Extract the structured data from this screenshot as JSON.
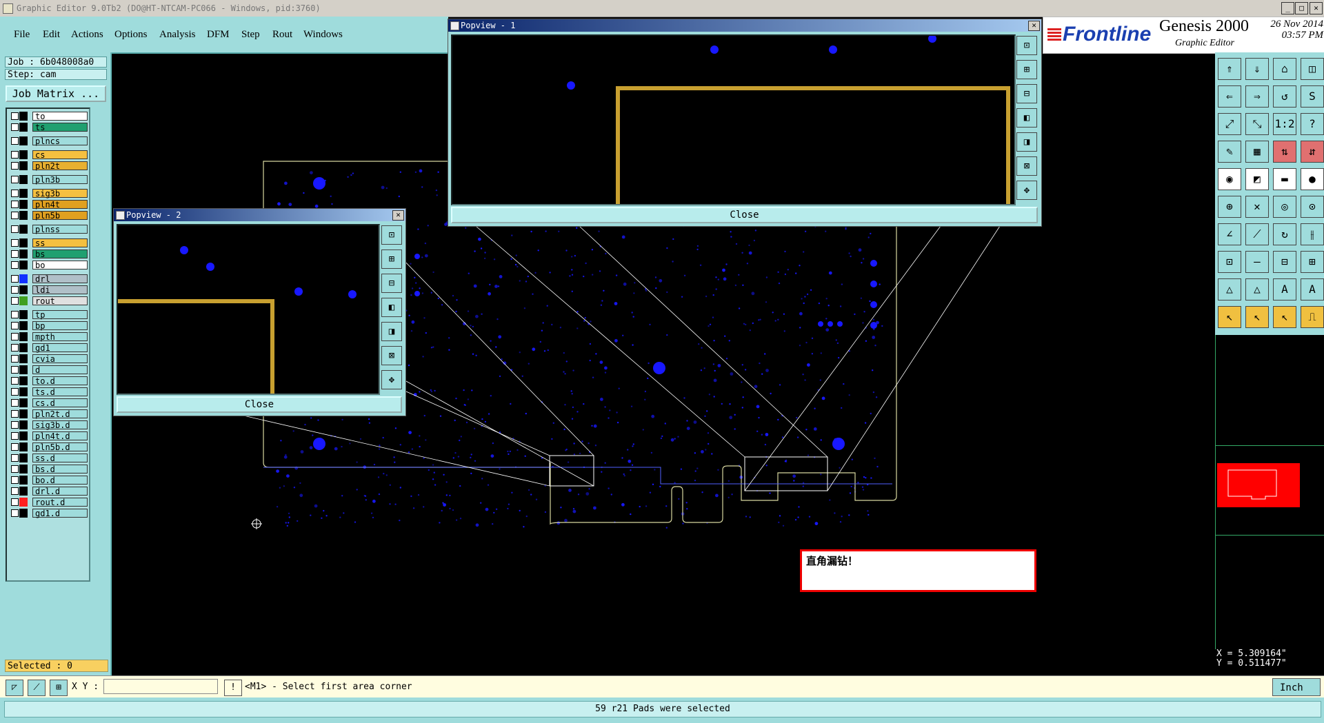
{
  "window": {
    "title": "Graphic Editor 9.0Tb2 (DO@HT-NTCAM-PC066 - Windows, pid:3760)",
    "min": "_",
    "max": "□",
    "close": "✕"
  },
  "menu": [
    "File",
    "Edit",
    "Actions",
    "Options",
    "Analysis",
    "DFM",
    "Step",
    "Rout",
    "Windows"
  ],
  "brand": {
    "logo": "Frontline",
    "product": "Genesis 2000",
    "subtitle": "Graphic Editor",
    "date": "26 Nov 2014",
    "time": "03:57 PM"
  },
  "job": {
    "job_label": "Job : 6b048008a0",
    "step_label": "Step: cam",
    "matrix_button": "Job Matrix ..."
  },
  "layers": [
    {
      "name": "to",
      "color": "#ffffff",
      "sw": "#000000"
    },
    {
      "name": "ts",
      "color": "#20a070",
      "sw": "#000000"
    },
    {
      "name": "plncs",
      "color": "#9fdcdc",
      "sw": "#000000",
      "gap": true
    },
    {
      "name": "cs",
      "color": "#f5c040",
      "sw": "#000000",
      "gap": true
    },
    {
      "name": "pln2t",
      "color": "#e8b030",
      "sw": "#000000"
    },
    {
      "name": "pln3b",
      "color": "#9fdcdc",
      "sw": "#000000",
      "gap": true
    },
    {
      "name": "sig3b",
      "color": "#f5c040",
      "sw": "#000000",
      "gap": true
    },
    {
      "name": "pln4t",
      "color": "#e0a020",
      "sw": "#000000"
    },
    {
      "name": "pln5b",
      "color": "#e0a020",
      "sw": "#000000"
    },
    {
      "name": "plnss",
      "color": "#9fdcdc",
      "sw": "#000000",
      "gap": true
    },
    {
      "name": "ss",
      "color": "#f5c040",
      "sw": "#000000",
      "gap": true
    },
    {
      "name": "bs",
      "color": "#20a070",
      "sw": "#000000"
    },
    {
      "name": "bo",
      "color": "#ffffff",
      "sw": "#000000"
    },
    {
      "name": "drl",
      "color": "#b0c0c8",
      "sw": "#1030ff",
      "gap": true
    },
    {
      "name": "ldi",
      "color": "#b0c0c8",
      "sw": "#000000"
    },
    {
      "name": "rout",
      "color": "#e0e0e0",
      "sw": "#40a020"
    },
    {
      "name": "tp",
      "color": "#9fdcdc",
      "sw": "#000000",
      "gap": true
    },
    {
      "name": "bp",
      "color": "#9fdcdc",
      "sw": "#000000"
    },
    {
      "name": "mpth",
      "color": "#9fdcdc",
      "sw": "#000000"
    },
    {
      "name": "gd1",
      "color": "#9fdcdc",
      "sw": "#000000"
    },
    {
      "name": "cvia",
      "color": "#9fdcdc",
      "sw": "#000000"
    },
    {
      "name": "d",
      "color": "#9fdcdc",
      "sw": "#000000"
    },
    {
      "name": "to.d",
      "color": "#9fdcdc",
      "sw": "#000000"
    },
    {
      "name": "ts.d",
      "color": "#9fdcdc",
      "sw": "#000000"
    },
    {
      "name": "cs.d",
      "color": "#9fdcdc",
      "sw": "#000000"
    },
    {
      "name": "pln2t.d",
      "color": "#9fdcdc",
      "sw": "#000000"
    },
    {
      "name": "sig3b.d",
      "color": "#9fdcdc",
      "sw": "#000000"
    },
    {
      "name": "pln4t.d",
      "color": "#9fdcdc",
      "sw": "#000000"
    },
    {
      "name": "pln5b.d",
      "color": "#9fdcdc",
      "sw": "#000000"
    },
    {
      "name": "ss.d",
      "color": "#9fdcdc",
      "sw": "#000000"
    },
    {
      "name": "bs.d",
      "color": "#9fdcdc",
      "sw": "#000000"
    },
    {
      "name": "bo.d",
      "color": "#9fdcdc",
      "sw": "#000000"
    },
    {
      "name": "drl.d",
      "color": "#9fdcdc",
      "sw": "#000000"
    },
    {
      "name": "rout.d",
      "color": "#9fdcdc",
      "sw": "#ff2020"
    },
    {
      "name": "gd1.d",
      "color": "#9fdcdc",
      "sw": "#000000"
    }
  ],
  "selected": "Selected : 0",
  "popview1": {
    "title": "Popview - 1",
    "close": "Close"
  },
  "popview2": {
    "title": "Popview - 2",
    "close": "Close"
  },
  "message": "直角漏钻！",
  "coords": {
    "x": "X = 5.309164\"",
    "y": "Y = 0.511477\""
  },
  "cmd": {
    "xy_label": "X Y :",
    "xy_value": "",
    "prompt": "<M1> - Select first area corner",
    "excl": "!",
    "units": "Inch"
  },
  "status": "59 r21 Pads were selected",
  "colors": {
    "panel": "#9fdcdc",
    "board_outline": "#d8d8a0",
    "pad": "#1818ff",
    "trace": "#c8a030"
  }
}
